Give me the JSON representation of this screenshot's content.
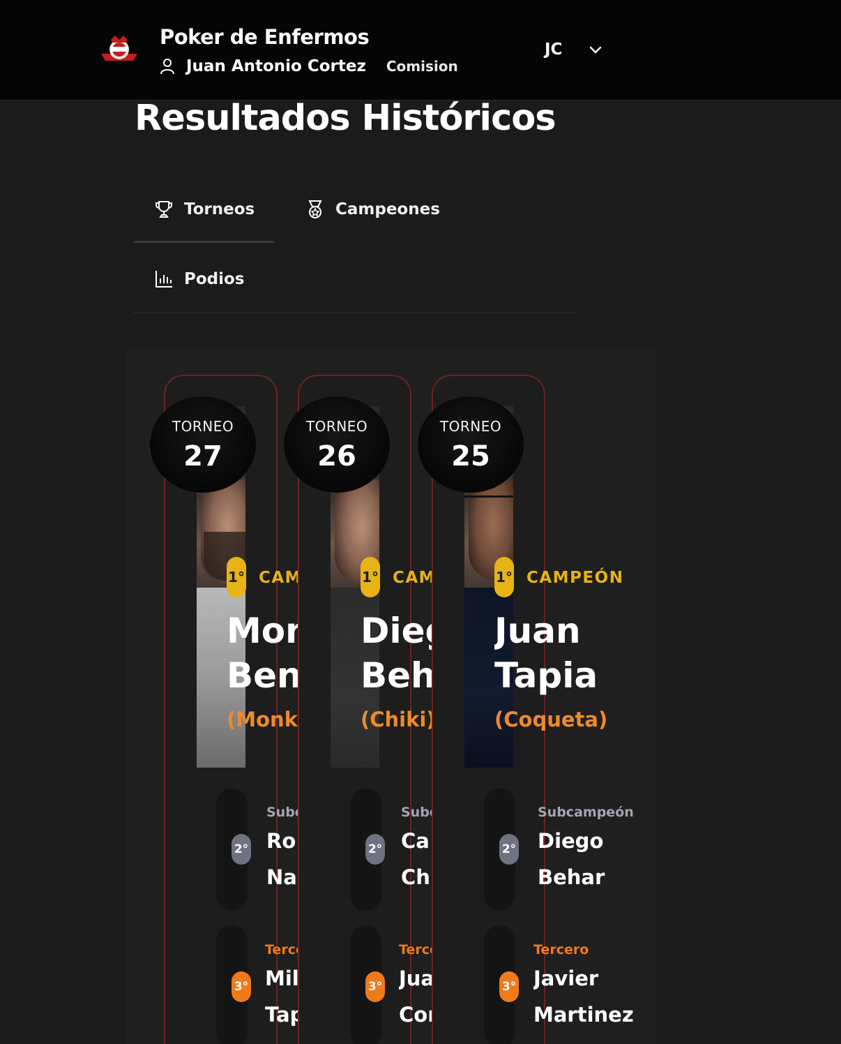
{
  "header": {
    "app_title": "Poker de Enfermos",
    "user_name": "Juan Antonio Cortez",
    "role_link": "Comision",
    "initials": "JC",
    "icons": [
      "logo-icon",
      "user-icon",
      "chevron-down-icon"
    ]
  },
  "page": {
    "title": "Resultados Históricos"
  },
  "tabs": [
    {
      "label": "Torneos",
      "icon": "trophy-icon",
      "active": true
    },
    {
      "label": "Campeones",
      "icon": "medal-icon",
      "active": false
    },
    {
      "label": "Podios",
      "icon": "bar-chart-icon",
      "active": false
    }
  ],
  "tournaments": [
    {
      "label": "TORNEO",
      "number": "27",
      "first_badge": "1°",
      "first_label": "CAMPEÓN",
      "first_name_line1": "Mono",
      "first_name_line2": "Benites",
      "first_nick": "(Monkey)",
      "second_badge": "2°",
      "second_label": "Subcampeón",
      "second_name_line1": "Ro",
      "second_name_line2": "Na",
      "third_badge": "3°",
      "third_label": "Tercero",
      "third_name_line1": "Mil",
      "third_name_line2": "Tap"
    },
    {
      "label": "TORNEO",
      "number": "26",
      "first_badge": "1°",
      "first_label": "CAMPEÓN",
      "first_name_line1": "Diego",
      "first_name_line2": "Behar",
      "first_nick": "(Chiki)",
      "second_badge": "2°",
      "second_label": "Subcampeón",
      "second_name_line1": "Ca",
      "second_name_line2": "Ch",
      "third_badge": "3°",
      "third_label": "Tercero",
      "third_name_line1": "Jua",
      "third_name_line2": "Cor"
    },
    {
      "label": "TORNEO",
      "number": "25",
      "first_badge": "1°",
      "first_label": "CAMPEÓN",
      "first_name_line1": "Juan",
      "first_name_line2": "Tapia",
      "first_nick": "(Coqueta)",
      "second_badge": "2°",
      "second_label": "Subcampeón",
      "second_name_line1": "Diego",
      "second_name_line2": "Behar",
      "third_badge": "3°",
      "third_label": "Tercero",
      "third_name_line1": "Javier",
      "third_name_line2": "Martinez"
    }
  ],
  "colors": {
    "gold": "#e7b315",
    "orange": "#f07a1a",
    "nick_orange": "#ee8a2c",
    "silver": "#6f7280",
    "card_border": "#6a2323"
  }
}
